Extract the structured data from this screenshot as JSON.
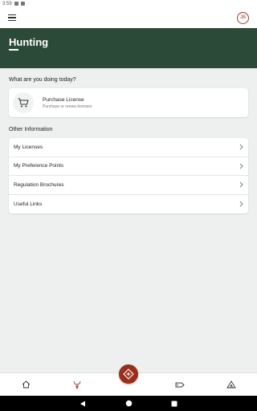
{
  "status_bar": {
    "time": "3:59"
  },
  "app_bar": {
    "avatar_initials": "JB"
  },
  "hero": {
    "title": "Hunting"
  },
  "today": {
    "heading": "What are you doing today?",
    "purchase": {
      "title": "Purchase License",
      "subtitle": "Purchase or renew licenses"
    }
  },
  "other": {
    "heading": "Other Information",
    "items": [
      {
        "label": "My Licenses"
      },
      {
        "label": "My Preference Points"
      },
      {
        "label": "Regulation Brochures"
      },
      {
        "label": "Useful Links"
      }
    ]
  },
  "bottom_nav": [
    "home-icon",
    "deer-icon",
    "fab-add-icon",
    "license-tag-icon",
    "tent-icon"
  ],
  "colors": {
    "brand_green": "#2b4a37",
    "accent_red": "#9b2d1a",
    "background": "#eef0f0"
  }
}
